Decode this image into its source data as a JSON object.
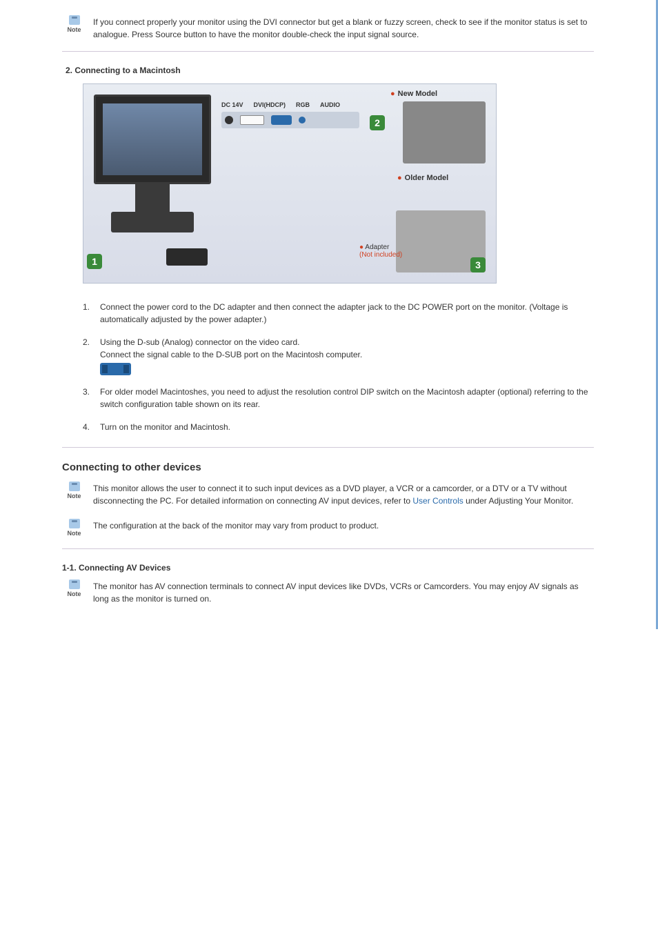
{
  "note1": {
    "text": "If you connect properly your monitor using the DVI connector but get a blank or fuzzy screen, check to see if the monitor status is set to analogue. Press Source button to have the monitor double-check the input signal source."
  },
  "section2": {
    "heading": "2. Connecting to a Macintosh",
    "diagram": {
      "newModelLabel": "New Model",
      "olderModelLabel": "Older Model",
      "adapterLabel": "Adapter",
      "adapterSublabel": "(Not included)",
      "portLabels": {
        "dc": "DC 14V",
        "dvi": "DVI(HDCP)",
        "rgb": "RGB",
        "audio": "AUDIO"
      },
      "callouts": {
        "c1": "1",
        "c2": "2",
        "c3": "3"
      }
    },
    "steps": [
      {
        "num": "1.",
        "text": "Connect the power cord to the DC adapter and then connect the adapter jack to the DC POWER port on the monitor. (Voltage is automatically adjusted by the power adapter.)"
      },
      {
        "num": "2.",
        "line1": "Using the D-sub (Analog) connector on the video card.",
        "line2": "Connect the signal cable to the D-SUB port on the Macintosh computer."
      },
      {
        "num": "3.",
        "text": "For older model Macintoshes, you need to adjust the resolution control DIP switch on the Macintosh adapter (optional) referring to the switch configuration table shown on its rear."
      },
      {
        "num": "4.",
        "text": "Turn on the monitor and Macintosh."
      }
    ]
  },
  "section3": {
    "heading": "Connecting to other devices",
    "note1": {
      "part1": "This monitor allows the user to connect it to such input devices as a DVD player, a VCR or a camcorder, or a DTV or a TV without disconnecting the PC. For detailed information on connecting AV input devices, refer to ",
      "link": "User Controls",
      "part2": " under Adjusting Your Monitor."
    },
    "note2": {
      "text": "The configuration at the back of the monitor may vary from product to product."
    }
  },
  "section4": {
    "heading": "1-1. Connecting AV Devices",
    "note": {
      "text": "The monitor has AV connection terminals to connect AV input devices like DVDs, VCRs or Camcorders. You may enjoy AV signals as long as the monitor is turned on."
    }
  },
  "noteLabel": "Note"
}
